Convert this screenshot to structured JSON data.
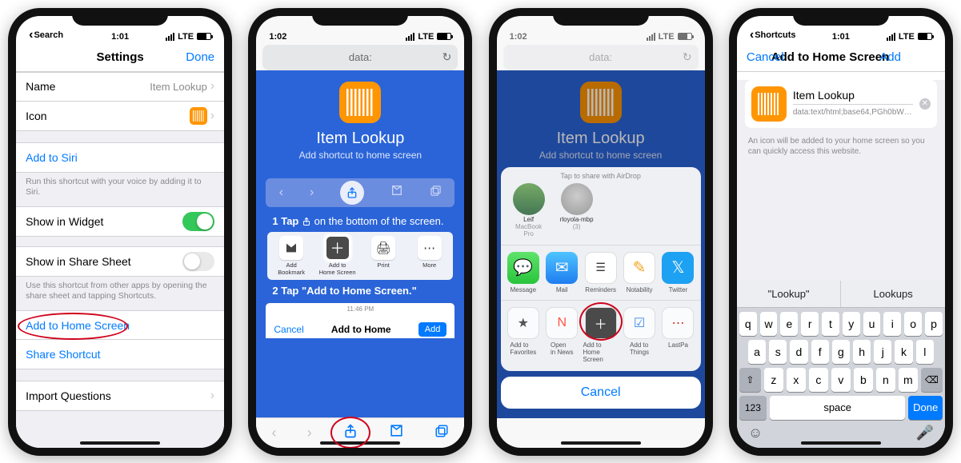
{
  "status": {
    "time": "1:01",
    "back": "Search",
    "carrier": "LTE",
    "back4": "Shortcuts",
    "safari_time": "1:02"
  },
  "p1": {
    "title": "Settings",
    "done": "Done",
    "name_label": "Name",
    "name_value": "Item Lookup",
    "icon_label": "Icon",
    "siri": "Add to Siri",
    "siri_foot": "Run this shortcut with your voice by adding it to Siri.",
    "widget": "Show in Widget",
    "sharesheet": "Show in Share Sheet",
    "sharesheet_foot": "Use this shortcut from other apps by opening the share sheet and tapping Shortcuts.",
    "addhome": "Add to Home Screen",
    "shareshortcut": "Share Shortcut",
    "import": "Import Questions"
  },
  "p2": {
    "addr": "data:",
    "title": "Item Lookup",
    "sub": "Add shortcut to home screen",
    "step1_pre": "1  Tap ",
    "step1_post": " on the bottom of the screen.",
    "step2": "2  Tap \"Add to Home Screen.\"",
    "acts": {
      "bookmark": "Add\nBookmark",
      "home": "Add to\nHome Screen",
      "print": "Print",
      "more": "More"
    },
    "mini": {
      "time": "11:46 PM",
      "cancel": "Cancel",
      "title": "Add to Home",
      "add": "Add"
    }
  },
  "p3": {
    "airdrop_label": "Tap to share with AirDrop",
    "ad1_name": "Leif",
    "ad1_sub": "MacBook Pro",
    "ad2_name": "rloyola-mbp",
    "ad2_sub": "(3)",
    "apps": {
      "msg": "Message",
      "mail": "Mail",
      "rem": "Reminders",
      "notab": "Notability",
      "tw": "Twitter"
    },
    "actions": {
      "fav": "Add to\nFavorites",
      "news": "Open\nin News",
      "home": "Add to\nHome Screen",
      "things": "Add to\nThings",
      "last": "LastPa"
    },
    "cancel": "Cancel"
  },
  "p4": {
    "cancel": "Cancel",
    "title": "Add to Home Screen",
    "add": "Add",
    "name": "Item Lookup",
    "url": "data:text/html;base64,PGh0bWw+Cjx...",
    "hint": "An icon will be added to your home screen so you can quickly access this website.",
    "sug1": "\"Lookup\"",
    "sug2": "Lookups",
    "space": "space",
    "done": "Done",
    "numkey": "123"
  }
}
